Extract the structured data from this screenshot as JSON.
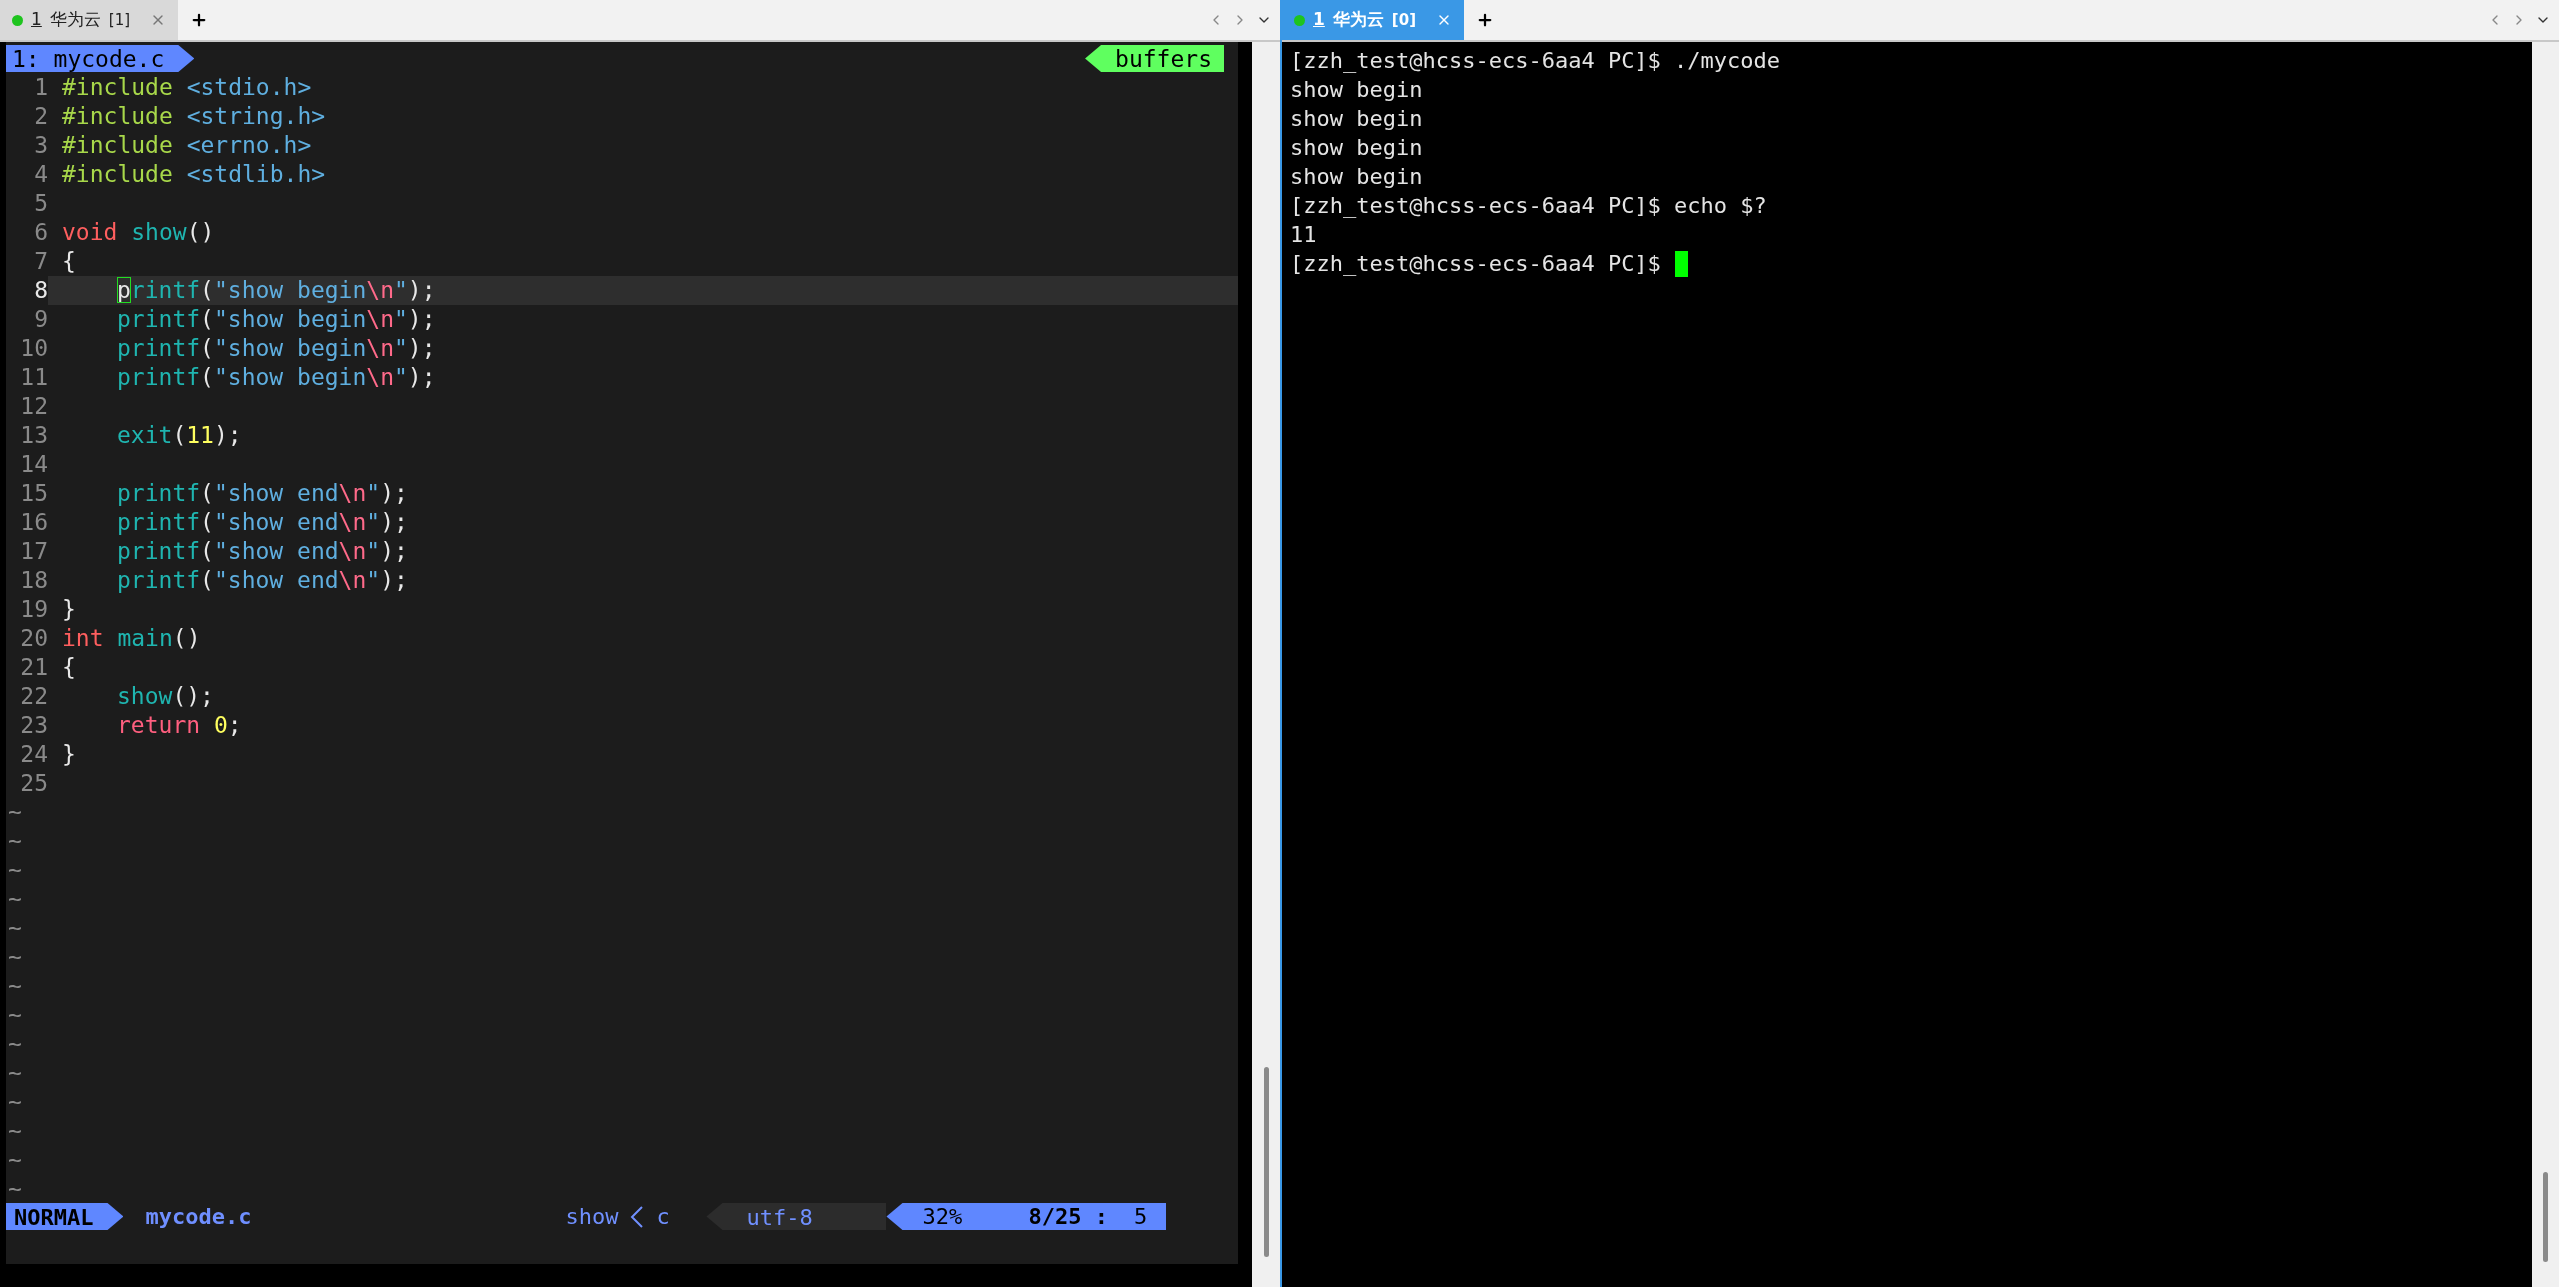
{
  "left_window": {
    "tab": {
      "number": "1",
      "title": "华为云",
      "session": "[1]",
      "selected": false
    },
    "vim": {
      "tabline": {
        "buffer": "1: mycode.c",
        "buffers_label": "buffers"
      },
      "lines": [
        {
          "number": "1",
          "current": false,
          "indented": false,
          "segments": [
            {
              "kind": "preproc",
              "text": "#include"
            },
            {
              "kind": "header",
              "text": " <stdio.h>"
            }
          ]
        },
        {
          "number": "2",
          "current": false,
          "indented": false,
          "segments": [
            {
              "kind": "preproc",
              "text": "#include"
            },
            {
              "kind": "header",
              "text": " <string.h>"
            }
          ]
        },
        {
          "number": "3",
          "current": false,
          "indented": false,
          "segments": [
            {
              "kind": "preproc",
              "text": "#include"
            },
            {
              "kind": "header",
              "text": " <errno.h>"
            }
          ]
        },
        {
          "number": "4",
          "current": false,
          "indented": false,
          "segments": [
            {
              "kind": "preproc",
              "text": "#include"
            },
            {
              "kind": "header",
              "text": " <stdlib.h>"
            }
          ]
        },
        {
          "number": "5",
          "current": false
        },
        {
          "number": "6",
          "current": false,
          "indented": false,
          "segments": [
            {
              "kind": "type",
              "text": "void"
            },
            {
              "kind": "func",
              "text": " show"
            },
            {
              "kind": "plain",
              "text": "()"
            }
          ]
        },
        {
          "number": "7",
          "current": false,
          "indented": false,
          "segments": [
            {
              "kind": "plain",
              "text": "{"
            }
          ]
        },
        {
          "number": "8",
          "current": true,
          "indented": true,
          "segments": [
            {
              "kind": "cursor",
              "text": "p"
            },
            {
              "kind": "func",
              "text": "rintf"
            },
            {
              "kind": "plain",
              "text": "("
            },
            {
              "kind": "string",
              "text": "\"show begin"
            },
            {
              "kind": "escape",
              "text": "\\n"
            },
            {
              "kind": "string",
              "text": "\""
            },
            {
              "kind": "plain",
              "text": ");"
            }
          ]
        },
        {
          "number": "9",
          "current": false,
          "indented": true,
          "segments": [
            {
              "kind": "func",
              "text": "printf"
            },
            {
              "kind": "plain",
              "text": "("
            },
            {
              "kind": "string",
              "text": "\"show begin"
            },
            {
              "kind": "escape",
              "text": "\\n"
            },
            {
              "kind": "string",
              "text": "\""
            },
            {
              "kind": "plain",
              "text": ");"
            }
          ]
        },
        {
          "number": "10",
          "current": false,
          "indented": true,
          "segments": [
            {
              "kind": "func",
              "text": "printf"
            },
            {
              "kind": "plain",
              "text": "("
            },
            {
              "kind": "string",
              "text": "\"show begin"
            },
            {
              "kind": "escape",
              "text": "\\n"
            },
            {
              "kind": "string",
              "text": "\""
            },
            {
              "kind": "plain",
              "text": ");"
            }
          ]
        },
        {
          "number": "11",
          "current": false,
          "indented": true,
          "segments": [
            {
              "kind": "func",
              "text": "printf"
            },
            {
              "kind": "plain",
              "text": "("
            },
            {
              "kind": "string",
              "text": "\"show begin"
            },
            {
              "kind": "escape",
              "text": "\\n"
            },
            {
              "kind": "string",
              "text": "\""
            },
            {
              "kind": "plain",
              "text": ");"
            }
          ]
        },
        {
          "number": "12",
          "current": false
        },
        {
          "number": "13",
          "current": false,
          "indented": true,
          "segments": [
            {
              "kind": "func",
              "text": "exit"
            },
            {
              "kind": "plain",
              "text": "("
            },
            {
              "kind": "number",
              "text": "11"
            },
            {
              "kind": "plain",
              "text": ");"
            }
          ]
        },
        {
          "number": "14",
          "current": false
        },
        {
          "number": "15",
          "current": false,
          "indented": true,
          "segments": [
            {
              "kind": "func",
              "text": "printf"
            },
            {
              "kind": "plain",
              "text": "("
            },
            {
              "kind": "string",
              "text": "\"show end"
            },
            {
              "kind": "escape",
              "text": "\\n"
            },
            {
              "kind": "string",
              "text": "\""
            },
            {
              "kind": "plain",
              "text": ");"
            }
          ]
        },
        {
          "number": "16",
          "current": false,
          "indented": true,
          "segments": [
            {
              "kind": "func",
              "text": "printf"
            },
            {
              "kind": "plain",
              "text": "("
            },
            {
              "kind": "string",
              "text": "\"show end"
            },
            {
              "kind": "escape",
              "text": "\\n"
            },
            {
              "kind": "string",
              "text": "\""
            },
            {
              "kind": "plain",
              "text": ");"
            }
          ]
        },
        {
          "number": "17",
          "current": false,
          "indented": true,
          "segments": [
            {
              "kind": "func",
              "text": "printf"
            },
            {
              "kind": "plain",
              "text": "("
            },
            {
              "kind": "string",
              "text": "\"show end"
            },
            {
              "kind": "escape",
              "text": "\\n"
            },
            {
              "kind": "string",
              "text": "\""
            },
            {
              "kind": "plain",
              "text": ");"
            }
          ]
        },
        {
          "number": "18",
          "current": false,
          "indented": true,
          "segments": [
            {
              "kind": "func",
              "text": "printf"
            },
            {
              "kind": "plain",
              "text": "("
            },
            {
              "kind": "string",
              "text": "\"show end"
            },
            {
              "kind": "escape",
              "text": "\\n"
            },
            {
              "kind": "string",
              "text": "\""
            },
            {
              "kind": "plain",
              "text": ");"
            }
          ]
        },
        {
          "number": "19",
          "current": false,
          "indented": false,
          "segments": [
            {
              "kind": "plain",
              "text": "}"
            }
          ]
        },
        {
          "number": "20",
          "current": false,
          "indented": false,
          "segments": [
            {
              "kind": "type",
              "text": "int"
            },
            {
              "kind": "func",
              "text": " main"
            },
            {
              "kind": "plain",
              "text": "()"
            }
          ]
        },
        {
          "number": "21",
          "current": false,
          "indented": false,
          "segments": [
            {
              "kind": "plain",
              "text": "{"
            }
          ]
        },
        {
          "number": "22",
          "current": false,
          "indented": true,
          "segments": [
            {
              "kind": "func",
              "text": "show"
            },
            {
              "kind": "plain",
              "text": "();"
            }
          ]
        },
        {
          "number": "23",
          "current": false,
          "indented": true,
          "segments": [
            {
              "kind": "keyword",
              "text": "return"
            },
            {
              "kind": "number",
              "text": " 0"
            },
            {
              "kind": "plain",
              "text": ";"
            }
          ]
        },
        {
          "number": "24",
          "current": false,
          "indented": false,
          "segments": [
            {
              "kind": "plain",
              "text": "}"
            }
          ]
        },
        {
          "number": "25",
          "current": false
        }
      ],
      "tildes": [
        "~",
        "~",
        "~",
        "~",
        "~",
        "~",
        "~",
        "~",
        "~",
        "~",
        "~",
        "~",
        "~",
        "~"
      ],
      "statusline": {
        "mode": "NORMAL",
        "file": "mycode.c",
        "function": "show",
        "filetype": "c",
        "encoding": "utf-8",
        "percent": "32%",
        "position": "8/25 :",
        "column": "5"
      }
    }
  },
  "right_window": {
    "tab": {
      "number": "1",
      "title": "华为云",
      "session": "[0]",
      "selected": true
    },
    "terminal": {
      "lines": [
        "[zzh_test@hcss-ecs-6aa4 PC]$ ./mycode",
        "show begin",
        "show begin",
        "show begin",
        "show begin",
        "[zzh_test@hcss-ecs-6aa4 PC]$ echo $?",
        "11",
        "[zzh_test@hcss-ecs-6aa4 PC]$"
      ],
      "cursor": true
    }
  }
}
